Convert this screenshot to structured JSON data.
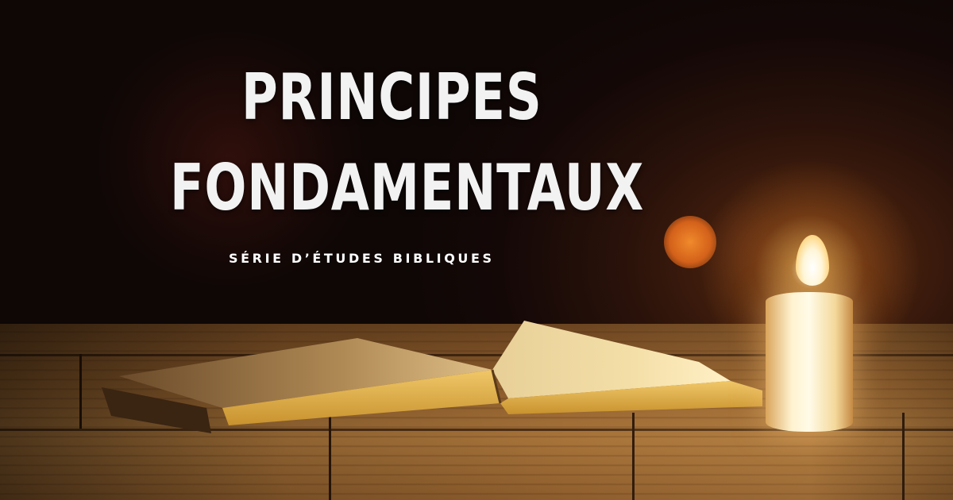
{
  "hero": {
    "title_line1": "PRINCIPES",
    "title_line2": "FONDAMENTAUX",
    "subtitle": "SÉRIE D’ÉTUDES BIBLIQUES"
  },
  "colors": {
    "title_text": "#f2f2f2",
    "background_dark": "#140807",
    "wood": "#a8743a",
    "candle_light": "#fff3d0"
  }
}
